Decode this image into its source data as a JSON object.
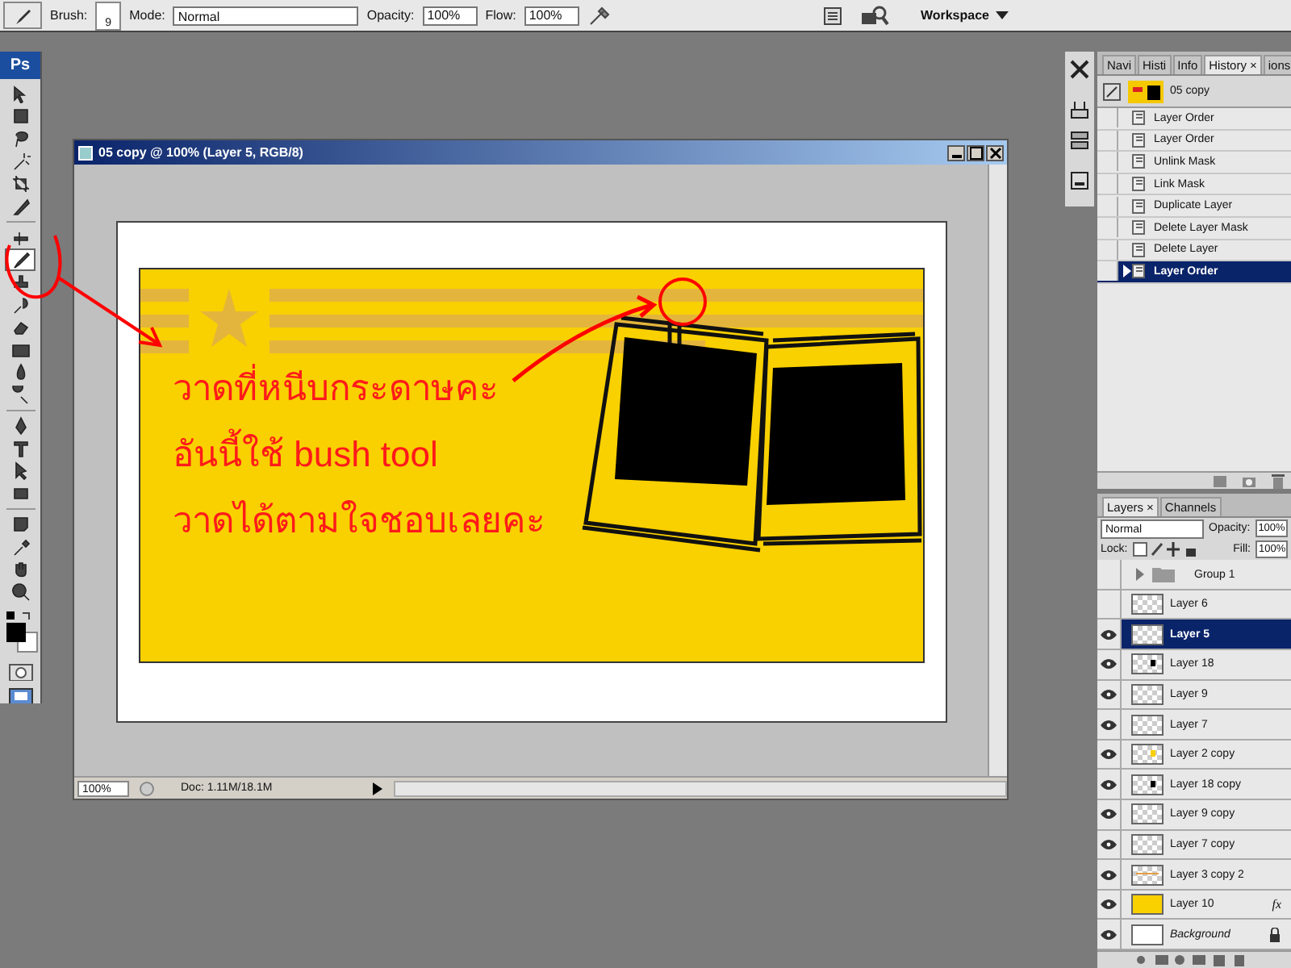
{
  "options_bar": {
    "brush_label": "Brush:",
    "brush_size": "9",
    "mode_label": "Mode:",
    "mode": "Normal",
    "opacity_label": "Opacity:",
    "opacity": "100%",
    "flow_label": "Flow:",
    "flow": "100%",
    "workspace": "Workspace"
  },
  "toolbar": {
    "logo": "Ps",
    "tools": [
      {
        "kind": "move",
        "selected": false
      },
      {
        "kind": "marquee",
        "selected": false
      },
      {
        "kind": "lasso",
        "selected": false
      },
      {
        "kind": "wand",
        "selected": false
      },
      {
        "kind": "crop",
        "selected": false
      },
      {
        "kind": "slice",
        "selected": false
      },
      {
        "kind": "heal",
        "selected": false
      },
      {
        "kind": "brush",
        "selected": true
      },
      {
        "kind": "stamp",
        "selected": false
      },
      {
        "kind": "history",
        "selected": false
      },
      {
        "kind": "eraser",
        "selected": false
      },
      {
        "kind": "gradient",
        "selected": false
      },
      {
        "kind": "blur",
        "selected": false
      },
      {
        "kind": "dodge",
        "selected": false
      },
      {
        "kind": "pen",
        "selected": false
      },
      {
        "kind": "type",
        "selected": false
      },
      {
        "kind": "select",
        "selected": false
      },
      {
        "kind": "shape",
        "selected": false
      },
      {
        "kind": "notes",
        "selected": false
      },
      {
        "kind": "eyedropper",
        "selected": false
      },
      {
        "kind": "hand",
        "selected": false
      },
      {
        "kind": "zoom",
        "selected": false
      }
    ]
  },
  "document": {
    "title": "05 copy @ 100% (Layer 5, RGB/8)",
    "canvas_lines": [
      "วาดที่หนีบกระดาษคะ",
      "อันนี้ใช้ bush tool",
      "วาดได้ตามใจชอบเลยคะ"
    ],
    "zoom": "100%",
    "doc_info": "Doc: 1.11M/18.1M"
  },
  "history_panel": {
    "tabs": [
      {
        "label": "Navi",
        "selected": false
      },
      {
        "label": "Histi",
        "selected": false
      },
      {
        "label": "Info",
        "selected": false
      },
      {
        "label": "History",
        "selected": true
      },
      {
        "label": "ions",
        "selected": false
      }
    ],
    "close": "×",
    "snapshot": "05 copy",
    "items": [
      {
        "label": "Layer Order",
        "selected": false
      },
      {
        "label": "Layer Order",
        "selected": false
      },
      {
        "label": "Unlink Mask",
        "selected": false
      },
      {
        "label": "Link Mask",
        "selected": false
      },
      {
        "label": "Duplicate Layer",
        "selected": false
      },
      {
        "label": "Delete Layer Mask",
        "selected": false
      },
      {
        "label": "Delete Layer",
        "selected": false
      },
      {
        "label": "Layer Order",
        "selected": true
      }
    ]
  },
  "layers_panel": {
    "tabs": [
      {
        "label": "Layers",
        "selected": true
      },
      {
        "label": "Channels",
        "selected": false
      }
    ],
    "close": "×",
    "blend_mode": "Normal",
    "opacity_label": "Opacity:",
    "opacity": "100%",
    "lock_label": "Lock:",
    "fill_label": "Fill:",
    "fill": "100%",
    "layers": [
      {
        "name": "Group 1",
        "kind": "group",
        "visible": false,
        "selected": false,
        "expanded": false
      },
      {
        "name": "Layer 6",
        "kind": "layer",
        "thumb": {
          "kind": "empty"
        },
        "visible": false,
        "selected": false
      },
      {
        "name": "Layer 5",
        "kind": "layer",
        "thumb": {
          "kind": "empty"
        },
        "visible": true,
        "selected": true
      },
      {
        "name": "Layer 18",
        "kind": "layer",
        "thumb": {
          "kind": "dark-dot"
        },
        "visible": true,
        "selected": false
      },
      {
        "name": "Layer 9",
        "kind": "layer",
        "thumb": {
          "kind": "empty"
        },
        "visible": true,
        "selected": false
      },
      {
        "name": "Layer 7",
        "kind": "layer",
        "thumb": {
          "kind": "empty"
        },
        "visible": true,
        "selected": false
      },
      {
        "name": "Layer 2 copy",
        "kind": "layer",
        "thumb": {
          "kind": "yellow-dot"
        },
        "visible": true,
        "selected": false
      },
      {
        "name": "Layer 18 copy",
        "kind": "layer",
        "thumb": {
          "kind": "dark-dot"
        },
        "visible": true,
        "selected": false
      },
      {
        "name": "Layer 9 copy",
        "kind": "layer",
        "thumb": {
          "kind": "empty"
        },
        "visible": true,
        "selected": false
      },
      {
        "name": "Layer 7 copy",
        "kind": "layer",
        "thumb": {
          "kind": "empty"
        },
        "visible": true,
        "selected": false
      },
      {
        "name": "Layer 3 copy 2",
        "kind": "layer",
        "thumb": {
          "kind": "stripe"
        },
        "visible": true,
        "selected": false
      },
      {
        "name": "Layer 10",
        "kind": "layer",
        "thumb": {
          "kind": "yellow"
        },
        "visible": true,
        "selected": false,
        "fx": "fx"
      },
      {
        "name": "Background",
        "kind": "background",
        "thumb": {
          "kind": "white"
        },
        "visible": true,
        "selected": false
      }
    ]
  }
}
